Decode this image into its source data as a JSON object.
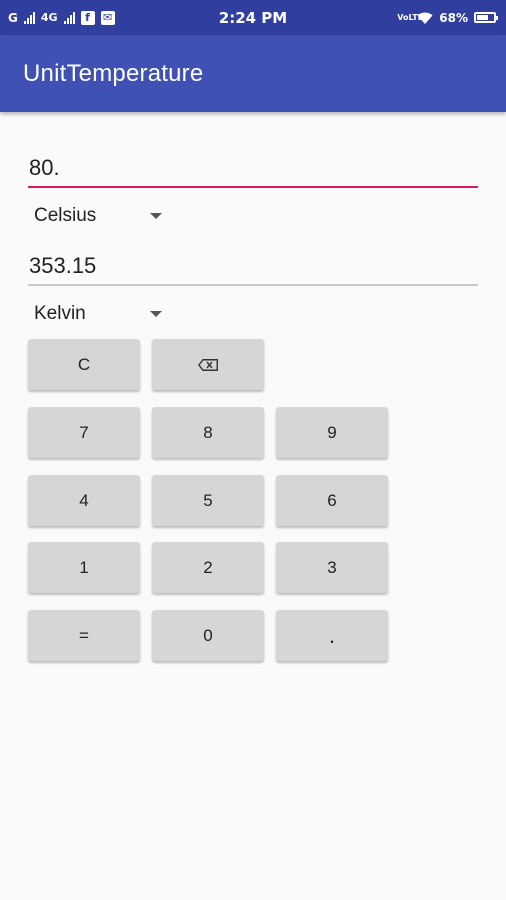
{
  "status_bar": {
    "time": "2:24 PM",
    "carrier_left": "G",
    "network_type": "4G",
    "volte": "VoLTE",
    "battery_percent": "68%",
    "battery_level": 0.68,
    "facebook_badge": "f",
    "notification_badge": "✉"
  },
  "app_bar": {
    "title": "UnitTemperature"
  },
  "converter": {
    "input_value": "80.",
    "from_unit": "Celsius",
    "output_value": "353.15",
    "to_unit": "Kelvin"
  },
  "keypad": {
    "clear": "C",
    "k7": "7",
    "k8": "8",
    "k9": "9",
    "k4": "4",
    "k5": "5",
    "k6": "6",
    "k1": "1",
    "k2": "2",
    "k3": "3",
    "equals": "=",
    "k0": "0",
    "dot": "."
  },
  "colors": {
    "primary_dark": "#303f9f",
    "primary": "#3f51b5",
    "accent": "#d81b60",
    "key_background": "#d6d6d6"
  },
  "icons": {
    "backspace": "backspace-icon",
    "dropdown": "triangle-down-icon",
    "wifi": "wifi-icon",
    "signal": "signal-icon",
    "battery": "battery-icon"
  }
}
